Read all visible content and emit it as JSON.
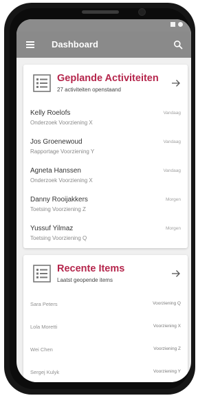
{
  "appbar": {
    "title": "Dashboard"
  },
  "planned": {
    "title": "Geplande Activiteiten",
    "subtitle": "27 activiteiten openstaand",
    "items": [
      {
        "name": "Kelly Roelofs",
        "task": "Onderzoek Voorziening X",
        "when": "Vandaag"
      },
      {
        "name": "Jos Groenewoud",
        "task": "Rapportage Voorziening Y",
        "when": "Vandaag"
      },
      {
        "name": "Agneta Hanssen",
        "task": "Onderzoek Voorziening X",
        "when": "Vandaag"
      },
      {
        "name": "Danny Rooijakkers",
        "task": "Toetsing Voorziening Z",
        "when": "Morgen"
      },
      {
        "name": "Yussuf Yilmaz",
        "task": "Toetsing Voorziening Q",
        "when": "Morgen"
      }
    ]
  },
  "recent": {
    "title": "Recente Items",
    "subtitle": "Laatst geopende items",
    "items": [
      {
        "name": "Sara Peters",
        "item": "Voorziening Q"
      },
      {
        "name": "Lola Moretti",
        "item": "Voorziening X"
      },
      {
        "name": "Wei Chen",
        "item": "Voorziening Z"
      },
      {
        "name": "Sergej Kulyk",
        "item": "Voorziening Y"
      }
    ]
  },
  "icons": {
    "menu": "hamburger-menu-icon",
    "search": "search-icon",
    "card": "document-list-icon",
    "arrow": "arrow-right-icon"
  },
  "colors": {
    "accent": "#b5264c",
    "appbar": "#8a8a8a",
    "background": "#f0f0f0"
  }
}
